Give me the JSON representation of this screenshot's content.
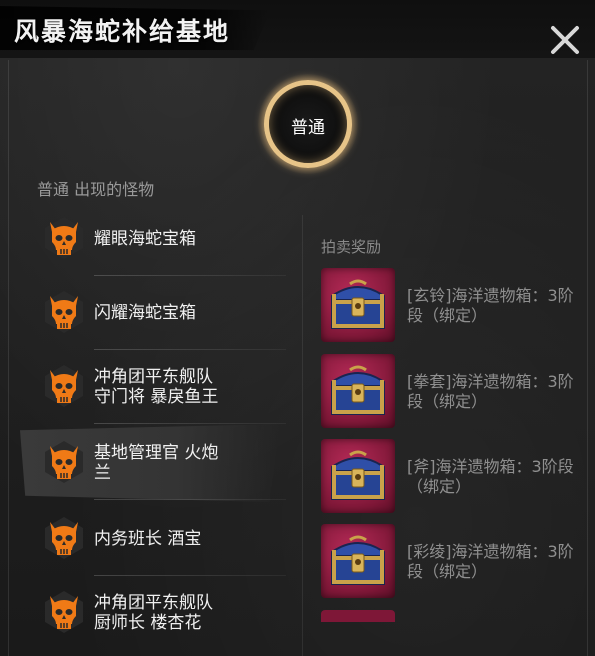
{
  "header": {
    "title": "风暴海蛇补给基地"
  },
  "difficulty": {
    "label": "普通"
  },
  "monsters_section": {
    "title": "普通 出现的怪物",
    "items": [
      {
        "label": "耀眼海蛇宝箱"
      },
      {
        "label": "闪耀海蛇宝箱"
      },
      {
        "label": "冲角团平东舰队\n守门将 暴戾鱼王"
      },
      {
        "label": "基地管理官 火炮\n兰"
      },
      {
        "label": "内务班长 酒宝"
      },
      {
        "label": "冲角团平东舰队\n厨师长 楼杏花"
      }
    ]
  },
  "rewards_section": {
    "title": "拍卖奖励",
    "items": [
      {
        "label": "[玄铃]海洋遗物箱：3阶段（绑定）"
      },
      {
        "label": "[拳套]海洋遗物箱：3阶段（绑定）"
      },
      {
        "label": "[斧]海洋遗物箱：3阶段（绑定）"
      },
      {
        "label": "[彩绫]海洋遗物箱：3阶段（绑定）"
      }
    ]
  },
  "colors": {
    "monster_icon": "#f07a16",
    "difficulty_ring": "#e7c488",
    "reward_bg": "#9e1f45"
  }
}
